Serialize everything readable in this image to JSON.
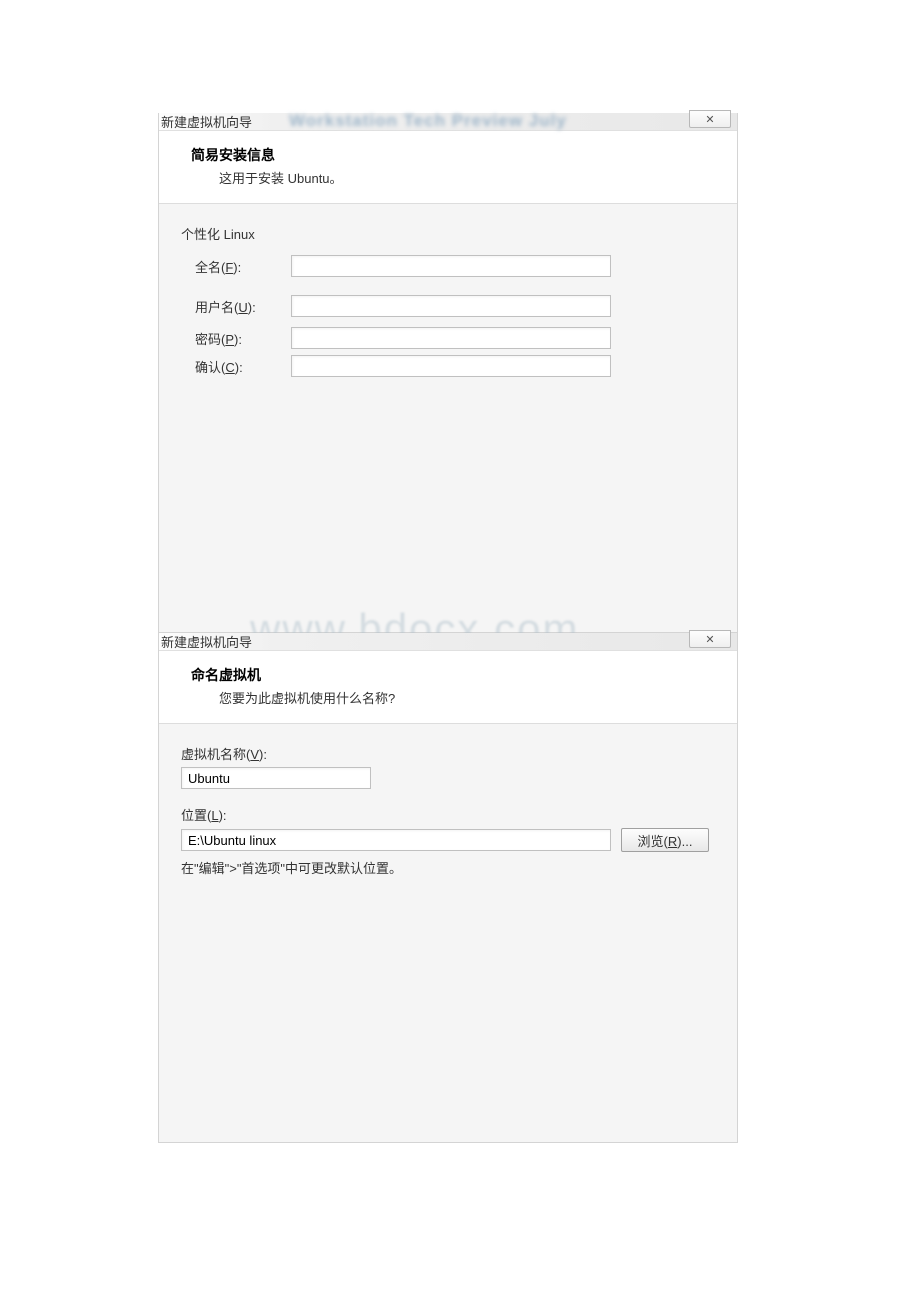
{
  "dialog1": {
    "title": "新建虚拟机向导",
    "title_blur": "Workstation Tech Preview July",
    "close_symbol": "✕",
    "header_title": "简易安装信息",
    "header_subtitle": "这用于安装 Ubuntu。",
    "section_label": "个性化 Linux",
    "fullname_label_prefix": "全名(",
    "fullname_label_key": "F",
    "fullname_label_suffix": "):",
    "fullname_value": "",
    "username_label_prefix": "用户名(",
    "username_label_key": "U",
    "username_label_suffix": "):",
    "username_value": "",
    "password_label_prefix": "密码(",
    "password_label_key": "P",
    "password_label_suffix": "):",
    "password_value": "",
    "confirm_label_prefix": "确认(",
    "confirm_label_key": "C",
    "confirm_label_suffix": "):",
    "confirm_value": ""
  },
  "dialog2": {
    "title": "新建虚拟机向导",
    "close_symbol": "✕",
    "header_title": "命名虚拟机",
    "header_subtitle": "您要为此虚拟机使用什么名称?",
    "vmname_label_prefix": "虚拟机名称(",
    "vmname_label_key": "V",
    "vmname_label_suffix": "):",
    "vmname_value": "Ubuntu",
    "location_label_prefix": "位置(",
    "location_label_key": "L",
    "location_label_suffix": "):",
    "location_value": "E:\\Ubuntu linux",
    "browse_label_prefix": "浏览(",
    "browse_label_key": "R",
    "browse_label_suffix": ")...",
    "hint_text": "在\"编辑\">\"首选项\"中可更改默认位置。"
  },
  "watermark": "www.bdocx.com"
}
